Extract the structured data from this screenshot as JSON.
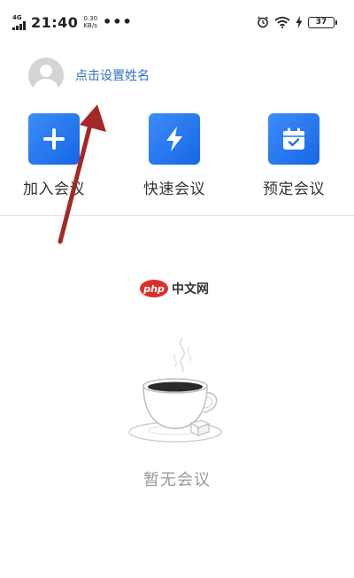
{
  "status_bar": {
    "network_type": "4G",
    "time": "21:40",
    "net_speed_value": "0.30",
    "net_speed_unit": "KB/s",
    "more": "•••",
    "battery_level": "37"
  },
  "profile": {
    "set_name_prompt": "点击设置姓名"
  },
  "actions": [
    {
      "label": "加入会议",
      "icon": "plus-icon"
    },
    {
      "label": "快速会议",
      "icon": "lightning-icon"
    },
    {
      "label": "预定会议",
      "icon": "calendar-check-icon"
    }
  ],
  "watermark": {
    "logo_text": "php",
    "site_text": "中文网"
  },
  "empty_state": {
    "message": "暂无会议"
  },
  "colors": {
    "accent_blue": "#1f74f0",
    "link_blue": "#2c6fc9",
    "annotation_arrow": "#a3282a",
    "muted_text": "#9a9a9a"
  }
}
